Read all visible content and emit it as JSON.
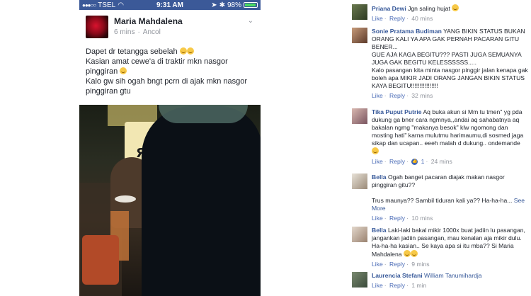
{
  "status_bar": {
    "carrier": "TSEL",
    "time": "9:31 AM",
    "battery": "98%"
  },
  "post": {
    "author": "Maria Mahdalena",
    "time": "6 mins",
    "location": "Ancol",
    "lines": [
      "Dapet dr tetangga sebelah",
      "Kasian amat cewe'a di traktir mkn nasgor pinggiran",
      "Kalo gw sih ogah bngt pcrn di ajak mkn nasgor pinggiran gtu"
    ],
    "photo_sign": "ЯЕЛ"
  },
  "comments": [
    {
      "name": "Priana Dewi",
      "text": "Jgn saling hujat",
      "like": "Like",
      "reply": "Reply",
      "time": "40 mins"
    },
    {
      "name": "Sonie Pratama Budiman",
      "text": "YANG BIKIN STATUS BUKAN ORANG KALI YA APA GAK PERNAH PACARAN GITU BENER...\nGUE AJA KAGA BEGITU??? PASTI JUGA SEMUANYA JUGA GAK BEGITU KELESSSSSS.....\nKalo pasangan kita minta nasgor pinggir jalan kenapa gak boleh apa MIKIR JADI ORANG JANGAN BIKIN STATUS KAYA BEGITU!!!!!!!!!!!!!!!!",
      "like": "Like",
      "reply": "Reply",
      "time": "32 mins"
    },
    {
      "name": "Tika Puput Putrie",
      "text": "Aq buka akun si Mm tu tmen\" yg pda dukung ga bner cara ngmnya,,andai aq sahabatnya aq bakalan ngmg \"makanya besok\" klw ngomong dan mosting hati\" karna mulutmu harimaumu,di sosmed jaga sikap dan ucapan.. eeeh malah d dukung.. ondemande",
      "like": "Like",
      "reply": "Reply",
      "likes": "1",
      "time": "24 mins"
    },
    {
      "name": "Bella",
      "text": "Ogah banget pacaran diajak makan nasgor pinggiran gitu??\n\nTrus maunya?? Sambil tiduran kali ya?? Ha-ha-ha...",
      "see_more": "See More",
      "like": "Like",
      "reply": "Reply",
      "time": "10 mins"
    },
    {
      "name": "Bella",
      "text": "Laki-laki bakal mikir 1000x buat jadiin lu pasangan, jangankan jadiin pasangan, mau kenalan aja mikir dulu. Ha-ha-ha kasian.. Se kaya apa si itu mba?? Si Maria Mahdalena",
      "like": "Like",
      "reply": "Reply",
      "time": "9 mins"
    },
    {
      "name": "Laurencia Stefani",
      "tag": "William Tanumihardja",
      "like": "Like",
      "reply": "Reply",
      "time": "1 min"
    }
  ]
}
